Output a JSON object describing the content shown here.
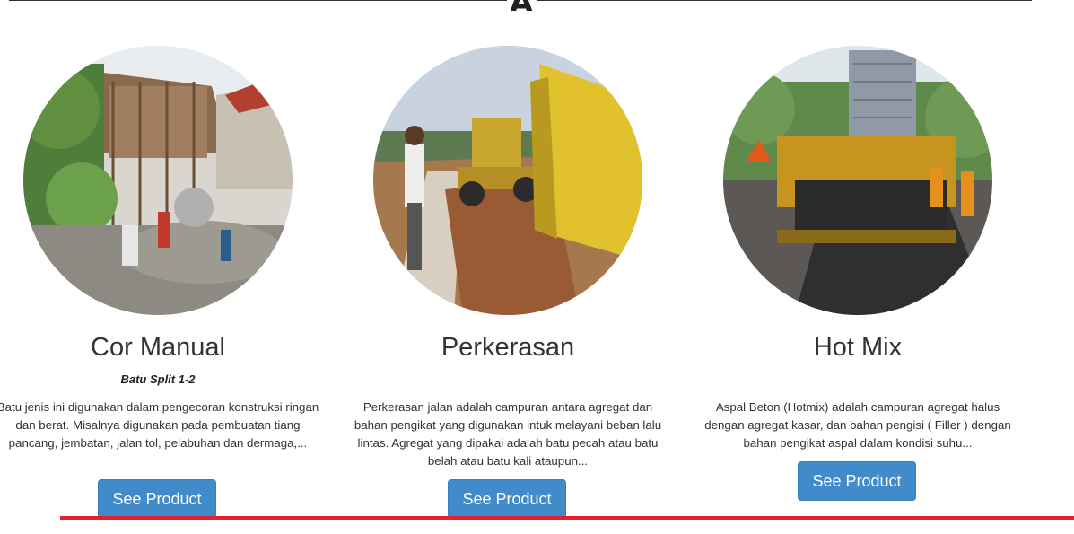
{
  "header": {
    "glyph": "A"
  },
  "products": [
    {
      "title": "Cor Manual",
      "subtitle": "Batu Split 1-2",
      "description": "Batu jenis ini digunakan dalam pengecoran konstruksi ringan dan berat. Misalnya digunakan pada pembuatan tiang pancang, jembatan, jalan tol, pelabuhan dan dermaga,...",
      "button_label": "See Product"
    },
    {
      "title": "Perkerasan",
      "description": "Perkerasan jalan adalah campuran antara agregat dan bahan pengikat yang digunakan intuk melayani beban lalu lintas. Agregat yang dipakai adalah batu pecah atau batu belah atau batu kali ataupun...",
      "button_label": "See Product"
    },
    {
      "title": "Hot Mix",
      "description": "Aspal Beton (Hotmix) adalah campuran agregat halus dengan agregat kasar, dan bahan pengisi ( Filler ) dengan bahan pengikat aspal dalam kondisi suhu...",
      "button_label": "See Product"
    }
  ],
  "colors": {
    "button": "#428bca",
    "accent_line": "#e3202e",
    "text": "#333333"
  }
}
